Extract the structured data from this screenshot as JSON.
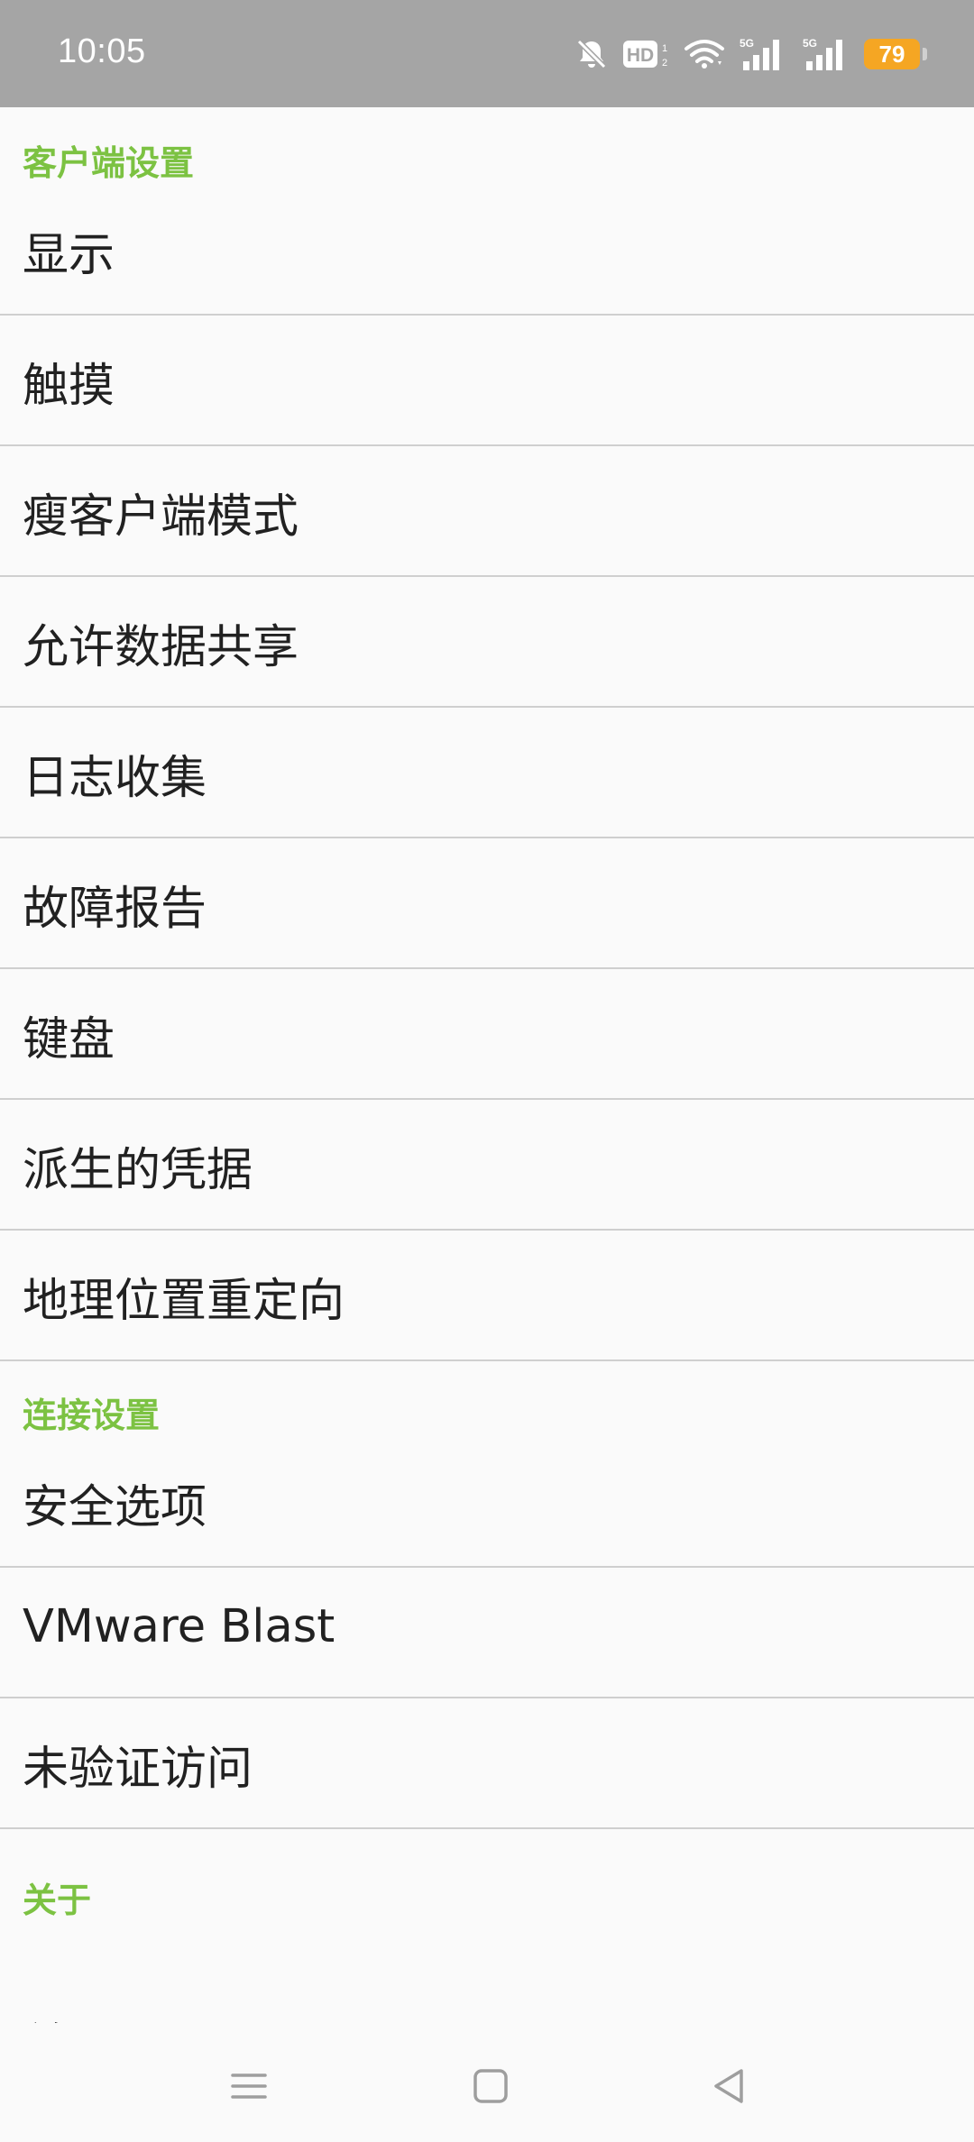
{
  "status_bar": {
    "time": "10:05",
    "battery_level": "79",
    "network_1": "5G",
    "network_2": "5G",
    "hd_badge": "HD",
    "icons": [
      "bell-off-icon",
      "hd-icon",
      "wifi-icon",
      "signal-5g-icon",
      "signal-5g-icon",
      "battery-icon"
    ],
    "battery_color": "#f5a623"
  },
  "sections": {
    "client": {
      "title": "客户端设置",
      "items": [
        "显示",
        "触摸",
        "瘦客户端模式",
        "允许数据共享",
        "日志收集",
        "故障报告",
        "键盘",
        "派生的凭据",
        "地理位置重定向"
      ]
    },
    "connection": {
      "title": "连接设置",
      "items": [
        "安全选项",
        "VMware Blast",
        "未验证访问"
      ]
    },
    "about": {
      "title": "关于",
      "items": [
        "关于 VMware Horizon Client"
      ]
    }
  },
  "nav_bar": {
    "icons": [
      "menu-icon",
      "home-icon",
      "back-icon"
    ]
  },
  "colors": {
    "accent": "#7cc242",
    "text": "#212121",
    "divider": "#cfcfcf",
    "status_bar": "#a5a5a5"
  }
}
